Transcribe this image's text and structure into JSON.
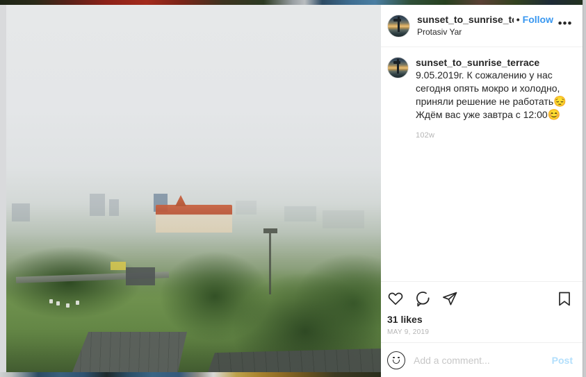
{
  "post": {
    "header": {
      "avatar_name": "profile-avatar",
      "username": "sunset_to_sunrise_terrac",
      "separator": "•",
      "follow_label": "Follow",
      "location": "Protasiv Yar",
      "more_options_glyph": "•••"
    },
    "caption": {
      "username": "sunset_to_sunrise_terrace",
      "text_line1": "9.05.2019г. К сожалению у нас",
      "text_line2": "сегодня опять мокро и холодно,",
      "text_line3": "приняли решение не работать",
      "emoji1": "😔",
      "text_line4": "Ждём вас уже завтра с 12:00",
      "emoji2": "😊",
      "full_text": "9.05.2019г. К сожалению у нас сегодня опять мокро и холодно, приняли решение не работать😔 Ждём вас уже завтра с 12:00😊",
      "time_ago": "102w"
    },
    "actions": {
      "like_icon": "heart-icon",
      "comment_icon": "comment-bubble-icon",
      "share_icon": "share-paper-plane-icon",
      "save_icon": "bookmark-icon",
      "likes_count": "31 likes",
      "date": "MAY 9, 2019"
    },
    "add_comment": {
      "emoji_icon": "emoji-smiley-icon",
      "placeholder": "Add a comment...",
      "post_label": "Post"
    },
    "media": {
      "name": "post-photo",
      "description": "Foggy overcast cityscape viewed from a hilltop terrace over Protasiv Yar, Kyiv: green trees and grass in the foreground with a grey wooden deck, mid-ground highway and low buildings, red-roofed apartment complex and hazy high-rises in the distance."
    }
  },
  "colors": {
    "follow_blue": "#3897f6",
    "post_blue": "#b2dffc",
    "text_primary": "#262626",
    "text_muted": "#b5b5b5",
    "divider": "#efefef",
    "background": "#ffffff",
    "window_chrome": "#d9dadc"
  }
}
